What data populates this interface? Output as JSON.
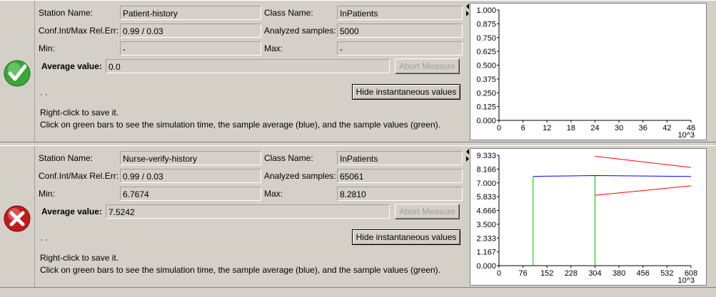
{
  "panels": [
    {
      "status": "ok",
      "status_icon": "check-icon",
      "station_label": "Station Name:",
      "station_value": "Patient-history",
      "class_label": "Class Name:",
      "class_value": "InPatients",
      "conf_label": "Conf.Int/Max Rel.Err:",
      "conf_value": "0.99 / 0.03",
      "samples_label": "Analyzed samples:",
      "samples_value": "5000",
      "min_label": "Min:",
      "min_value": "-",
      "max_label": "Max:",
      "max_value": "-",
      "avg_label": "Average value:",
      "avg_value": "0.0",
      "abort_label": "Abort Measure",
      "hide_label": "Hide instantaneous values",
      "note_cut": "                ·        ·",
      "note1": "Right-click to save it.",
      "note2": "Click on green bars to see the simulation time, the sample average (blue), and the sample values (green).",
      "chart_data": {
        "type": "line",
        "y_ticks": [
          "1.000",
          "0.875",
          "0.750",
          "0.625",
          "0.500",
          "0.375",
          "0.250",
          "0.125",
          "0.000"
        ],
        "x_ticks": [
          "0",
          "6",
          "12",
          "18",
          "24",
          "30",
          "36",
          "42",
          "48"
        ],
        "x_unit": "10^3",
        "ylim": [
          0,
          1
        ],
        "xlim": [
          0,
          48
        ],
        "series": []
      }
    },
    {
      "status": "failed",
      "status_icon": "cross-icon",
      "station_label": "Station Name:",
      "station_value": "Nurse-verify-history",
      "class_label": "Class Name:",
      "class_value": "InPatients",
      "conf_label": "Conf.Int/Max Rel.Err:",
      "conf_value": "0.99 / 0.03",
      "samples_label": "Analyzed samples:",
      "samples_value": "65061",
      "min_label": "Min:",
      "min_value": "6.7674",
      "max_label": "Max:",
      "max_value": "8.2810",
      "avg_label": "Average value:",
      "avg_value": "7.5242",
      "abort_label": "Abort Measure",
      "hide_label": "Hide instantaneous values",
      "note_cut": "                ·        ·",
      "note1": "Right-click to save it.",
      "note2": "Click on green bars to see the simulation time, the sample average (blue), and the sample values (green).",
      "chart_data": {
        "type": "line",
        "y_ticks": [
          "9.333",
          "8.166",
          "7.000",
          "5.833",
          "4.666",
          "3.500",
          "2.333",
          "1.167",
          "0.000"
        ],
        "x_ticks": [
          "0",
          "76",
          "152",
          "228",
          "304",
          "380",
          "456",
          "532",
          "608"
        ],
        "x_unit": "10^3",
        "ylim": [
          0,
          9.333
        ],
        "xlim": [
          0,
          608
        ],
        "average_series": {
          "color": "#0000ff",
          "points": [
            [
              108,
              7.55
            ],
            [
              200,
              7.58
            ],
            [
              304,
              7.62
            ],
            [
              608,
              7.54
            ]
          ]
        },
        "upper_bound": {
          "color": "#ff0000",
          "points": [
            [
              304,
              9.25
            ],
            [
              608,
              8.3
            ]
          ]
        },
        "lower_bound": {
          "color": "#ff0000",
          "points": [
            [
              304,
              5.95
            ],
            [
              608,
              6.75
            ]
          ]
        },
        "sample_bars": {
          "color": "#00c000",
          "x": [
            108,
            304
          ],
          "y": [
            7.55,
            7.62
          ]
        }
      }
    }
  ]
}
